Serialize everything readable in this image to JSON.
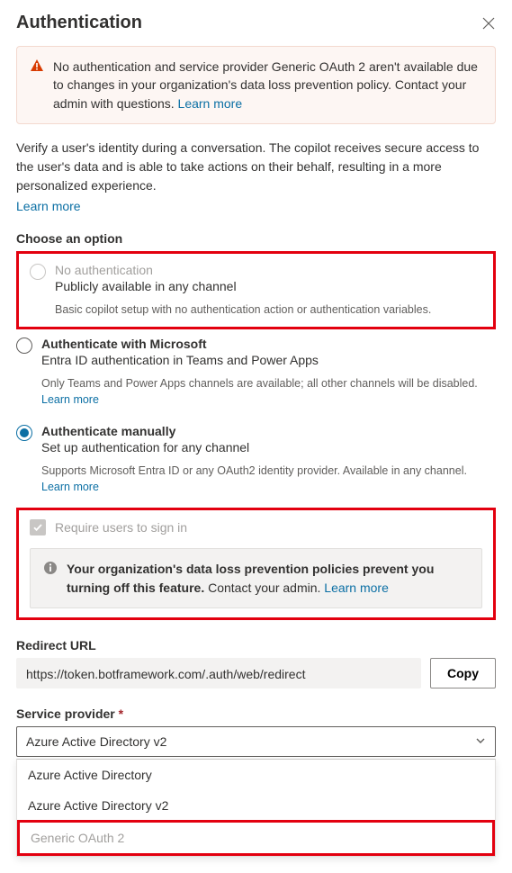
{
  "header": {
    "title": "Authentication"
  },
  "warning": {
    "text": "No authentication and service provider Generic OAuth 2 aren't available due to changes in your organization's data loss prevention policy. Contact your admin with questions. ",
    "learn_more": "Learn more"
  },
  "intro": {
    "text": "Verify a user's identity during a conversation. The copilot receives secure access to the user's data and is able to take actions on their behalf, resulting in a more personalized experience.",
    "learn_more": "Learn more"
  },
  "choose_label": "Choose an option",
  "options": {
    "none": {
      "title": "No authentication",
      "sub": "Publicly available in any channel",
      "note": "Basic copilot setup with no authentication action or authentication variables."
    },
    "msft": {
      "title": "Authenticate with Microsoft",
      "sub": "Entra ID authentication in Teams and Power Apps",
      "note": "Only Teams and Power Apps channels are available; all other channels will be disabled. ",
      "learn_more": "Learn more"
    },
    "manual": {
      "title": "Authenticate manually",
      "sub": "Set up authentication for any channel",
      "note": "Supports Microsoft Entra ID or any OAuth2 identity provider. Available in any channel. ",
      "learn_more": "Learn more"
    }
  },
  "require_signin": {
    "label": "Require users to sign in",
    "info_bold": "Your organization's data loss prevention policies prevent you turning off this feature.",
    "info_rest": " Contact your admin. ",
    "learn_more": "Learn more"
  },
  "redirect": {
    "label": "Redirect URL",
    "value": "https://token.botframework.com/.auth/web/redirect",
    "copy": "Copy"
  },
  "provider": {
    "label": "Service provider ",
    "selected": "Azure Active Directory v2",
    "options": [
      "Azure Active Directory",
      "Azure Active Directory v2",
      "Generic OAuth 2"
    ]
  }
}
